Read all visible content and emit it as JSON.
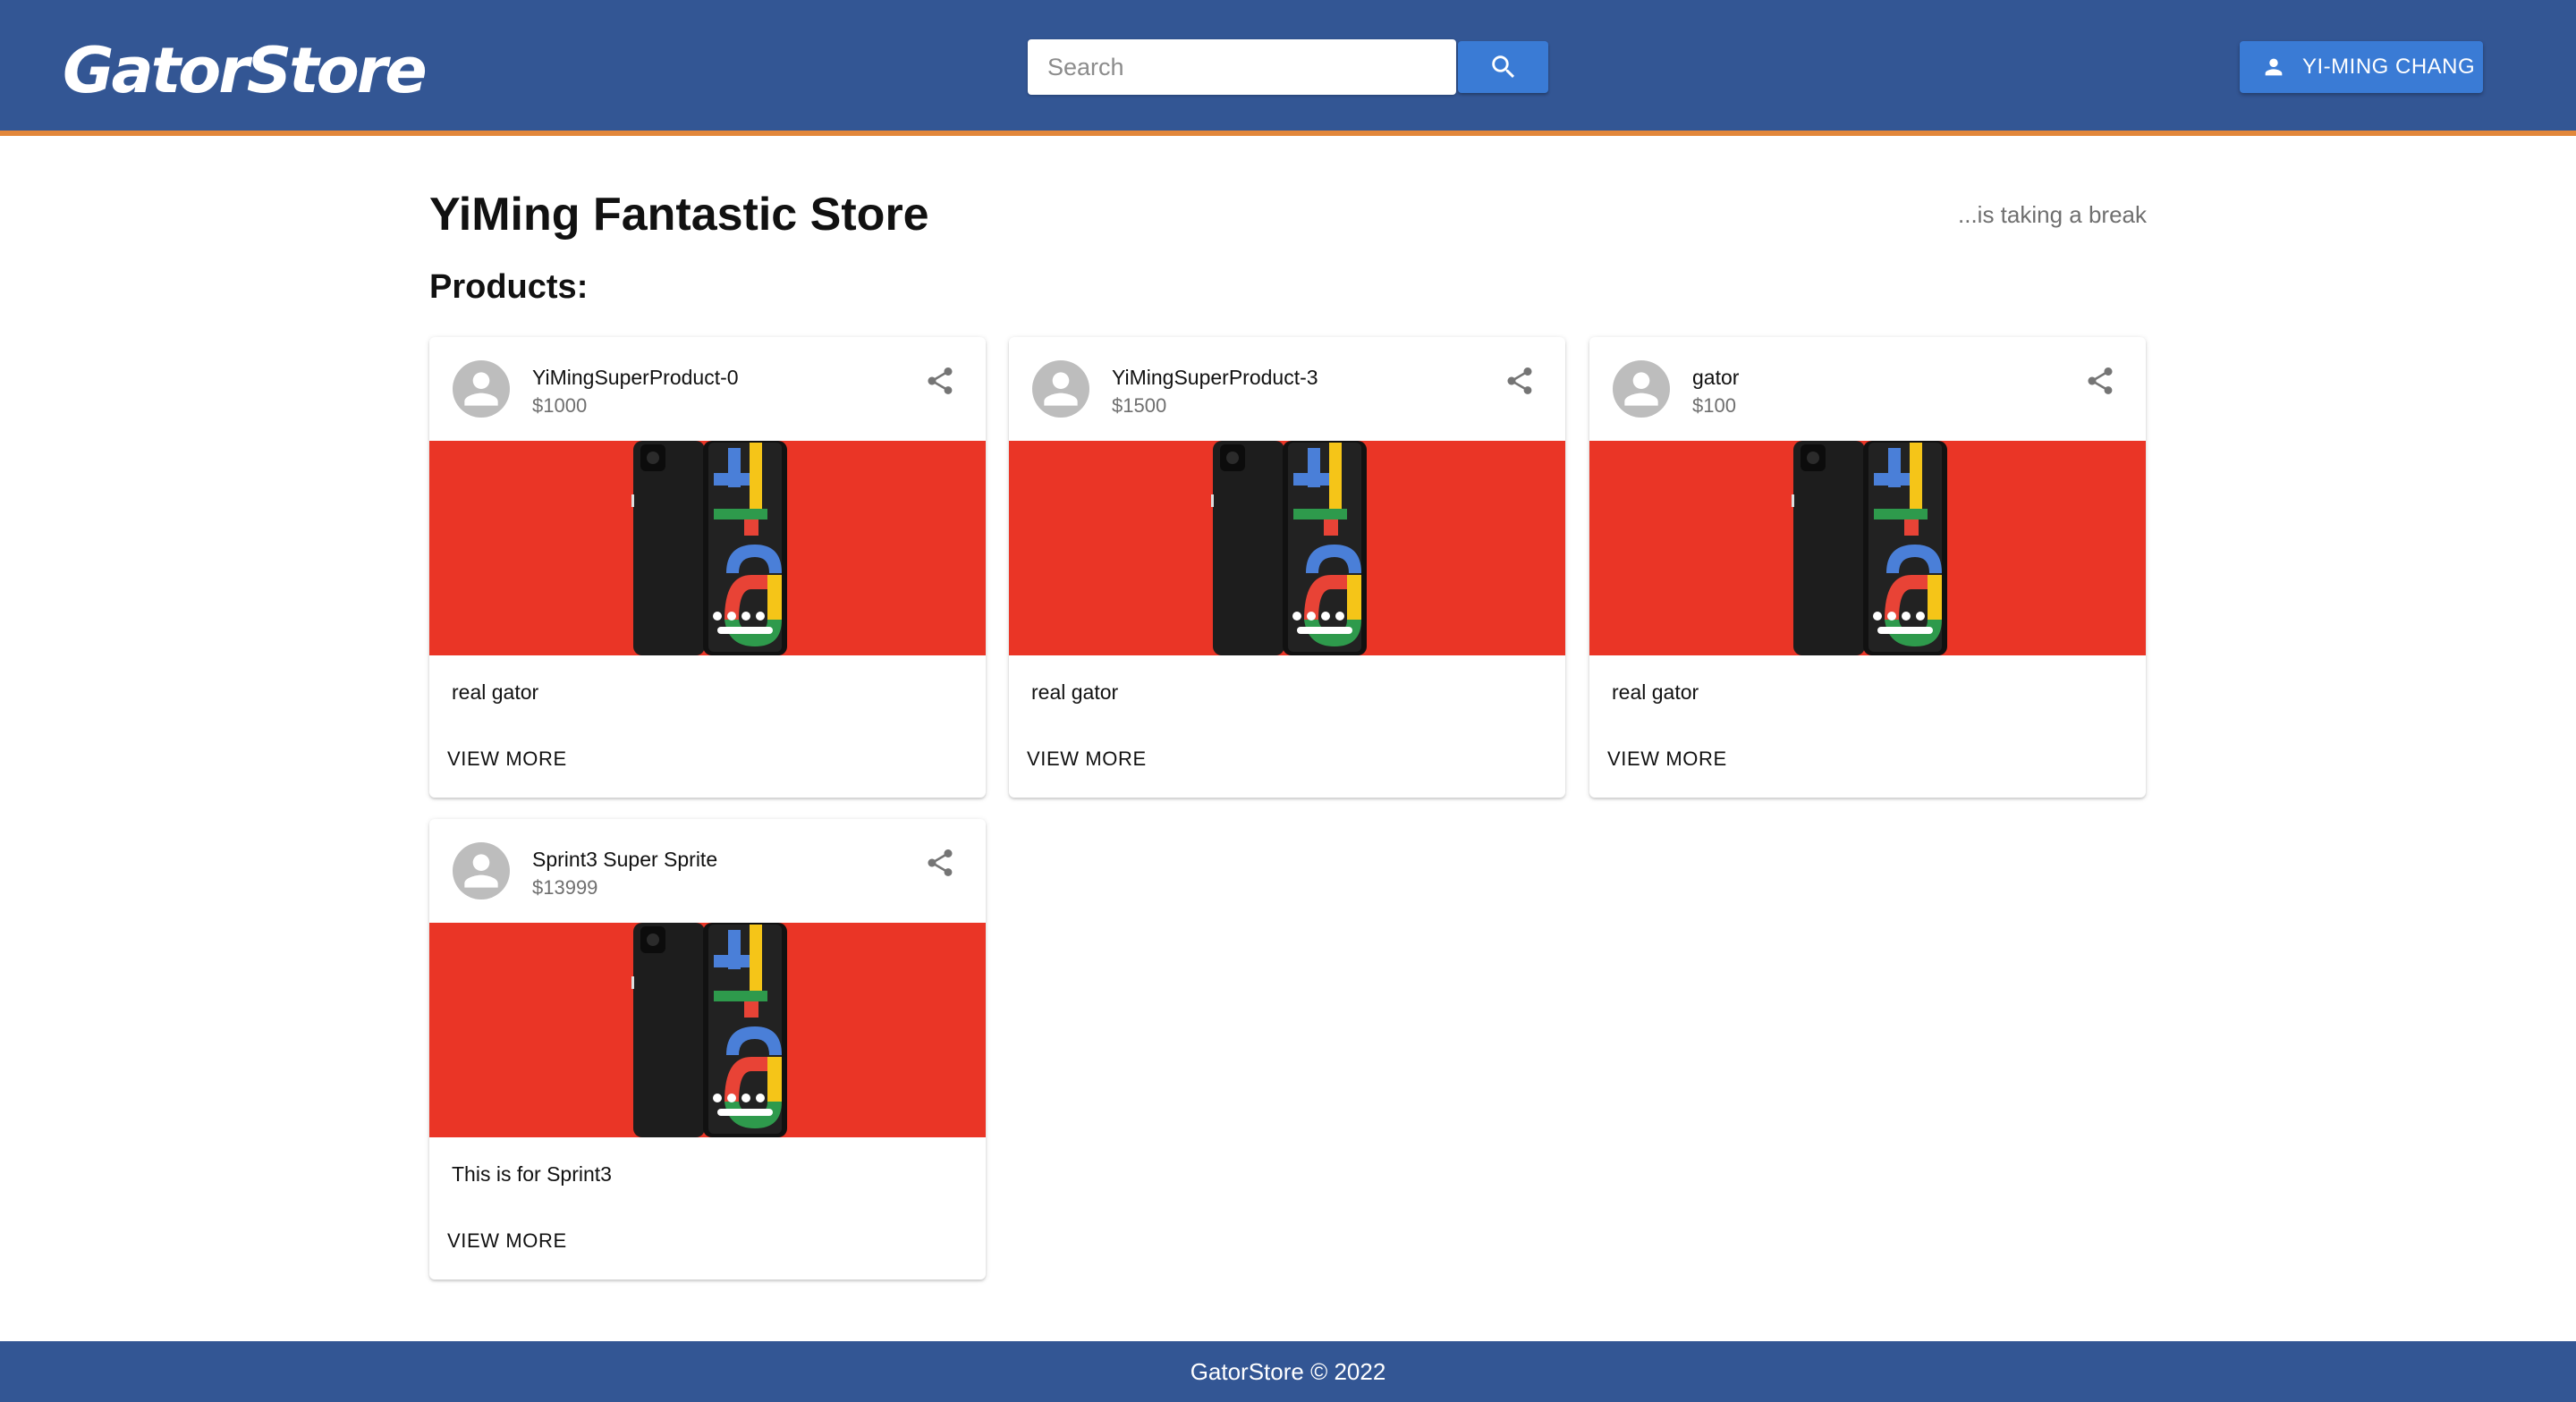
{
  "header": {
    "logo": "GatorStore",
    "search_placeholder": "Search",
    "search_value": "",
    "user_label": "YI-MING CHANG"
  },
  "store": {
    "title": "YiMing Fantastic Store",
    "status": "...is taking a break",
    "products_heading": "Products:"
  },
  "products": [
    {
      "title": "YiMingSuperProduct-0",
      "price": "$1000",
      "description": "real gator",
      "action": "VIEW MORE"
    },
    {
      "title": "YiMingSuperProduct-3",
      "price": "$1500",
      "description": "real gator",
      "action": "VIEW MORE"
    },
    {
      "title": "gator",
      "price": "$100",
      "description": "real gator",
      "action": "VIEW MORE"
    },
    {
      "title": "Sprint3 Super Sprite",
      "price": "$13999",
      "description": "This is for Sprint3",
      "action": "VIEW MORE"
    }
  ],
  "footer": {
    "text": "GatorStore © 2022"
  },
  "colors": {
    "header_bg": "#335694",
    "header_accent": "#e2873a",
    "button_blue": "#3a7bd5",
    "product_image_bg": "#ea3526"
  },
  "icons": {
    "search": "search-icon",
    "user": "person-icon",
    "avatar": "person-icon",
    "share": "share-icon"
  }
}
